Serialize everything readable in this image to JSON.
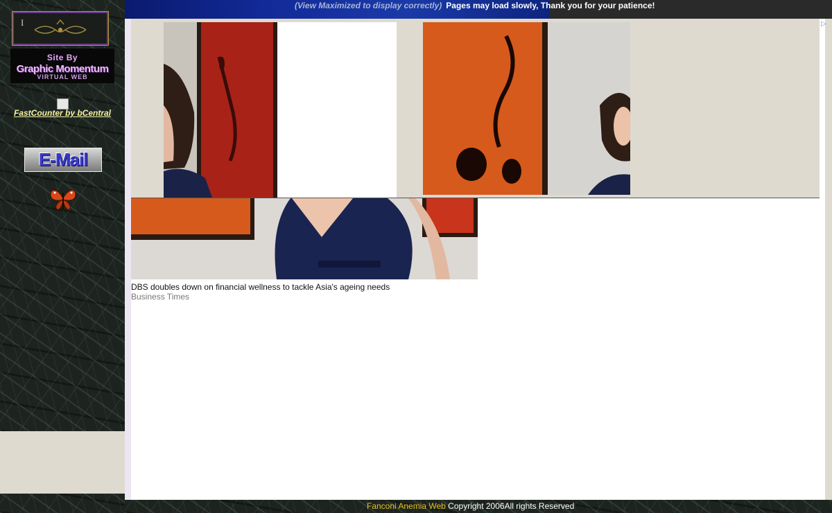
{
  "banner": {
    "italic_note": "(View Maximized to display correctly)",
    "bold_note": "Pages may load slowly, Thank you for your patience!"
  },
  "sidebar": {
    "site_by": {
      "line1": "Site By",
      "line2": "Graphic Momentum",
      "line3": "VIRTUAL WEB"
    },
    "counter_link": "FastCounter by bCentral",
    "email_button": "E-Mail",
    "icons": [
      "ornament-logo-icon",
      "butterfly-icon"
    ]
  },
  "ad": {
    "choices_icon": "▷"
  },
  "article": {
    "title": "DBS doubles down on financial wellness to tackle Asia's ageing needs",
    "source": "Business Times"
  },
  "footer": {
    "brand": "Fanconi  Anemia Web",
    "copyright": " Copyright 2006All rights Reserved"
  },
  "colors": {
    "footer_brand": "#e6c020",
    "counter_link": "#f4f0a0",
    "site_by_text": "#e8a8ff"
  }
}
